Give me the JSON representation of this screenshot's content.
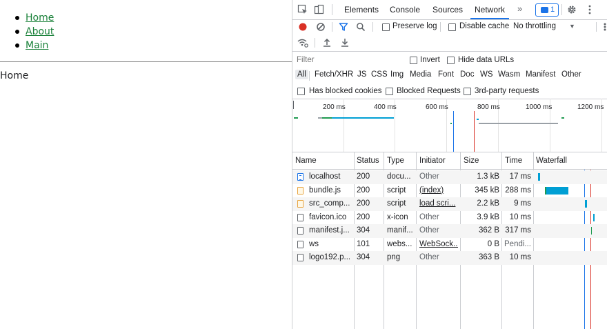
{
  "page": {
    "links": [
      "Home",
      "About",
      "Main"
    ],
    "current_view": "Home"
  },
  "devtools": {
    "tabs": [
      "Elements",
      "Console",
      "Sources",
      "Network"
    ],
    "active_tab": "Network",
    "more_tabs_glyph": "»",
    "issues_count": "1",
    "toolbar": {
      "preserve_log": "Preserve log",
      "disable_cache": "Disable cache",
      "throttling": "No throttling",
      "dropdown_glyph": "▼"
    },
    "filter": {
      "placeholder": "Filter",
      "invert": "Invert",
      "hide_data_urls": "Hide data URLs"
    },
    "types": [
      "All",
      "Fetch/XHR",
      "JS",
      "CSS",
      "Img",
      "Media",
      "Font",
      "Doc",
      "WS",
      "Wasm",
      "Manifest",
      "Other"
    ],
    "blocking": {
      "blocked_cookies": "Has blocked cookies",
      "blocked_requests": "Blocked Requests",
      "third_party": "3rd-party requests"
    },
    "overview_ticks": [
      "200 ms",
      "400 ms",
      "600 ms",
      "800 ms",
      "1000 ms",
      "1200 ms"
    ],
    "columns": [
      "Name",
      "Status",
      "Type",
      "Initiator",
      "Size",
      "Time",
      "Waterfall"
    ],
    "requests": [
      {
        "name": "localhost",
        "status": "200",
        "type": "docu...",
        "initiator": "Other",
        "initiator_link": false,
        "size": "1.3 kB",
        "time": "17 ms",
        "icon": "document-icon"
      },
      {
        "name": "bundle.js",
        "status": "200",
        "type": "script",
        "initiator": "(index)",
        "initiator_link": true,
        "size": "345 kB",
        "time": "288 ms",
        "icon": "script-icon"
      },
      {
        "name": "src_comp...",
        "status": "200",
        "type": "script",
        "initiator": "load scri...",
        "initiator_link": true,
        "size": "2.2 kB",
        "time": "9 ms",
        "icon": "script-icon"
      },
      {
        "name": "favicon.ico",
        "status": "200",
        "type": "x-icon",
        "initiator": "Other",
        "initiator_link": false,
        "size": "3.9 kB",
        "time": "10 ms",
        "icon": "file-icon"
      },
      {
        "name": "manifest.j...",
        "status": "304",
        "type": "manif...",
        "initiator": "Other",
        "initiator_link": false,
        "size": "362 B",
        "time": "317 ms",
        "icon": "file-icon"
      },
      {
        "name": "ws",
        "status": "101",
        "type": "webs...",
        "initiator": "WebSock...",
        "initiator_link": true,
        "size": "0 B",
        "time": "Pendi...",
        "icon": "file-icon"
      },
      {
        "name": "logo192.p...",
        "status": "304",
        "type": "png",
        "initiator": "Other",
        "initiator_link": false,
        "size": "363 B",
        "time": "10 ms",
        "icon": "file-icon"
      }
    ],
    "colors": {
      "accent": "#1a73e8",
      "record": "#d93025",
      "link_green": "#188038",
      "waterfall_blue": "#009fd4",
      "waterfall_green": "#1e9a4f",
      "load_line": "#d93025",
      "dcl_line": "#1a73e8"
    }
  }
}
